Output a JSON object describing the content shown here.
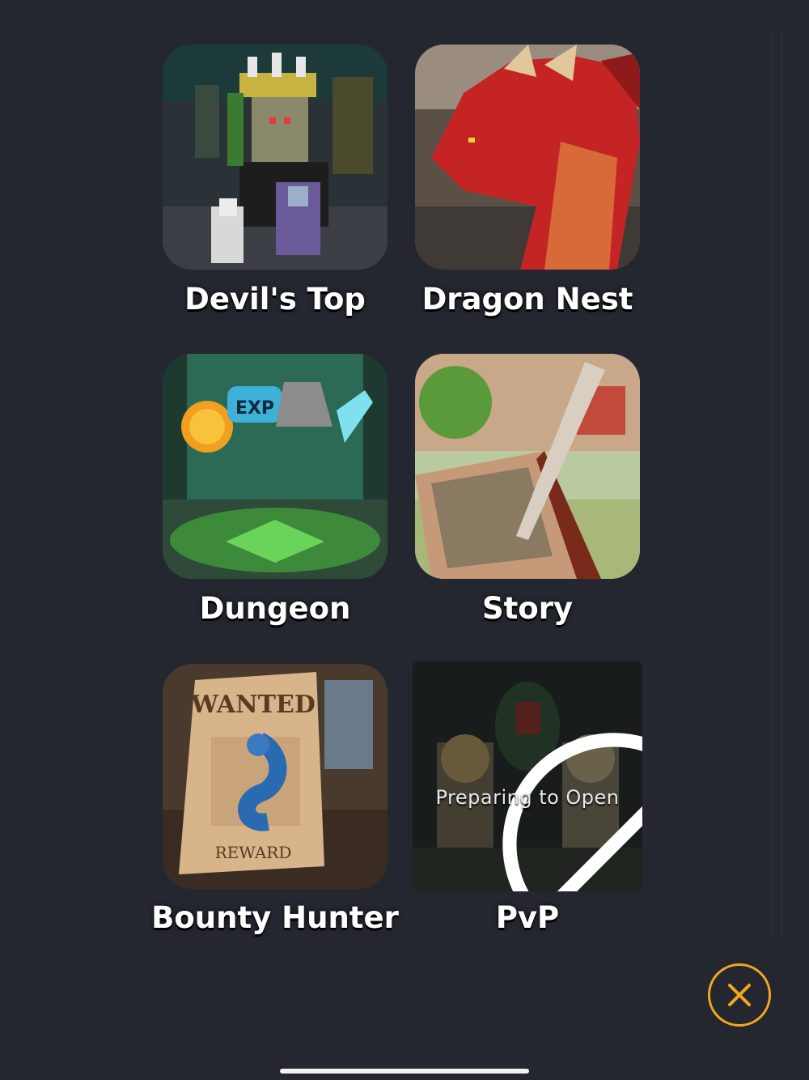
{
  "menu": {
    "items": [
      {
        "label": "Devil's Top",
        "icon": "devils-top-artwork"
      },
      {
        "label": "Dragon Nest",
        "icon": "dragon-artwork"
      },
      {
        "label": "Dungeon",
        "icon": "dungeon-artwork"
      },
      {
        "label": "Story",
        "icon": "story-book-artwork"
      },
      {
        "label": "Bounty Hunter",
        "icon": "wanted-poster-artwork"
      },
      {
        "label": "PvP",
        "icon": "pvp-artwork",
        "status": "Preparing to Open"
      }
    ]
  },
  "close_button": {
    "icon": "close-icon",
    "color": "#f2a81d"
  },
  "colors": {
    "background": "#242730",
    "accent": "#f2a81d"
  }
}
